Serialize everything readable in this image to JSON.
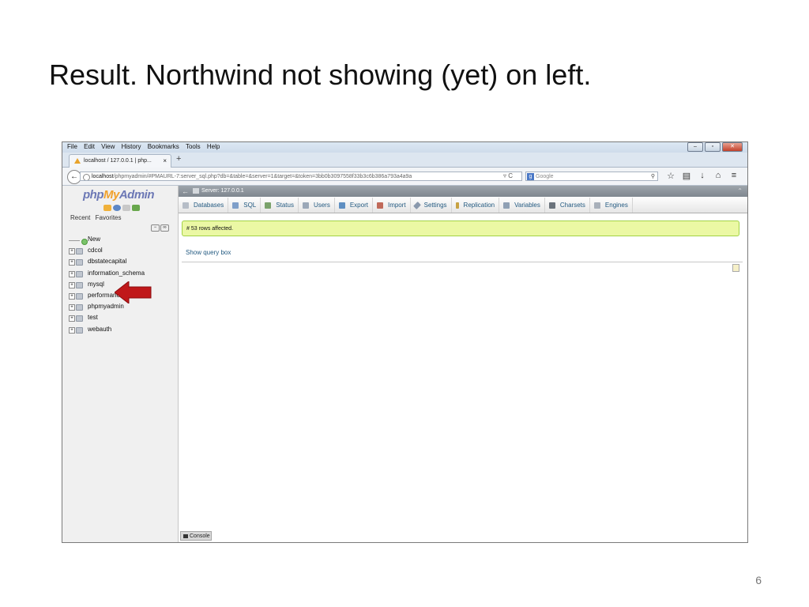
{
  "slide": {
    "title": "Result. Northwind not showing (yet) on left.",
    "page_number": "6"
  },
  "browser": {
    "menu": [
      "File",
      "Edit",
      "View",
      "History",
      "Bookmarks",
      "Tools",
      "Help"
    ],
    "tab_title": "localhost / 127.0.0.1 | php...",
    "url_host": "localhost",
    "url_rest": "/phpmyadmin/#PMAURL-7:server_sql.php?db=&table=&server=1&target=&token=3bb0b3097558f33b3c6b386a793a4a9a",
    "search_placeholder": "Google"
  },
  "pma": {
    "logo_php": "php",
    "logo_my": "My",
    "logo_admin": "Admin",
    "recent": "Recent",
    "favorites": "Favorites",
    "databases": [
      "New",
      "cdcol",
      "dbstatecapital",
      "information_schema",
      "mysql",
      "performance",
      "phpmyadmin",
      "test",
      "webauth"
    ],
    "server_label": "Server: 127.0.0.1",
    "tabs": [
      "Databases",
      "SQL",
      "Status",
      "Users",
      "Export",
      "Import",
      "Settings",
      "Replication",
      "Variables",
      "Charsets",
      "Engines"
    ],
    "message": "# 53 rows affected.",
    "show_query": "Show query box",
    "console": "Console"
  },
  "colors": {
    "success_bg": "#ebf8a4",
    "link": "#235a81",
    "arrow": "#c0181a"
  }
}
